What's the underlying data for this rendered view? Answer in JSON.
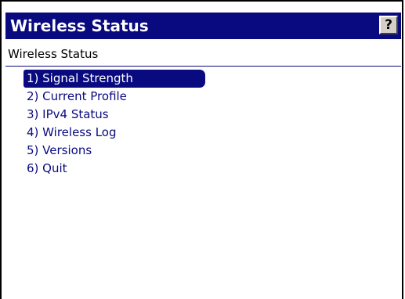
{
  "window": {
    "title": "Wireless Status",
    "help_label": "?"
  },
  "screen": {
    "subtitle": "Wireless Status"
  },
  "menu": {
    "items": [
      {
        "label": "1) Signal Strength",
        "selected": true
      },
      {
        "label": "2) Current Profile",
        "selected": false
      },
      {
        "label": "3) IPv4 Status",
        "selected": false
      },
      {
        "label": "4) Wireless Log",
        "selected": false
      },
      {
        "label": "5) Versions",
        "selected": false
      },
      {
        "label": "6) Quit",
        "selected": false
      }
    ]
  },
  "colors": {
    "titlebar": "#0a0a80",
    "menu_text": "#0a0a80",
    "selection": "#0a0a80"
  }
}
